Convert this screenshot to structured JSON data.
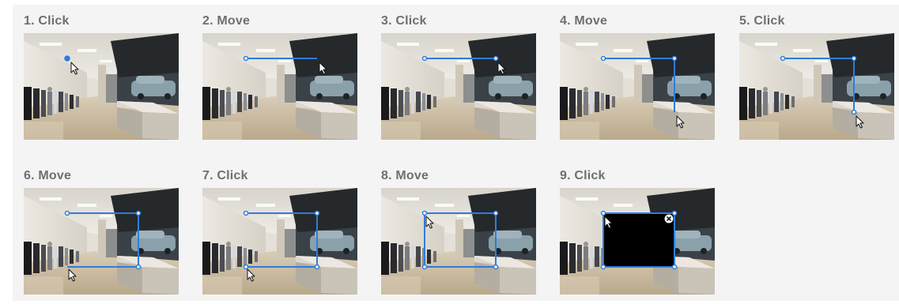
{
  "steps": [
    {
      "label": "1. Click"
    },
    {
      "label": "2. Move"
    },
    {
      "label": "3. Click"
    },
    {
      "label": "4. Move"
    },
    {
      "label": "5. Click"
    },
    {
      "label": "6. Move"
    },
    {
      "label": "7. Click"
    },
    {
      "label": "8. Move"
    },
    {
      "label": "9. Click"
    }
  ],
  "colors": {
    "accent": "#2e7ddb",
    "label_text": "#6f6f6f",
    "panel_bg": "#f4f4f4",
    "mask_fill": "#000000"
  },
  "icons": {
    "cursor": "arrow-cursor-icon",
    "close": "close-circle-icon"
  }
}
